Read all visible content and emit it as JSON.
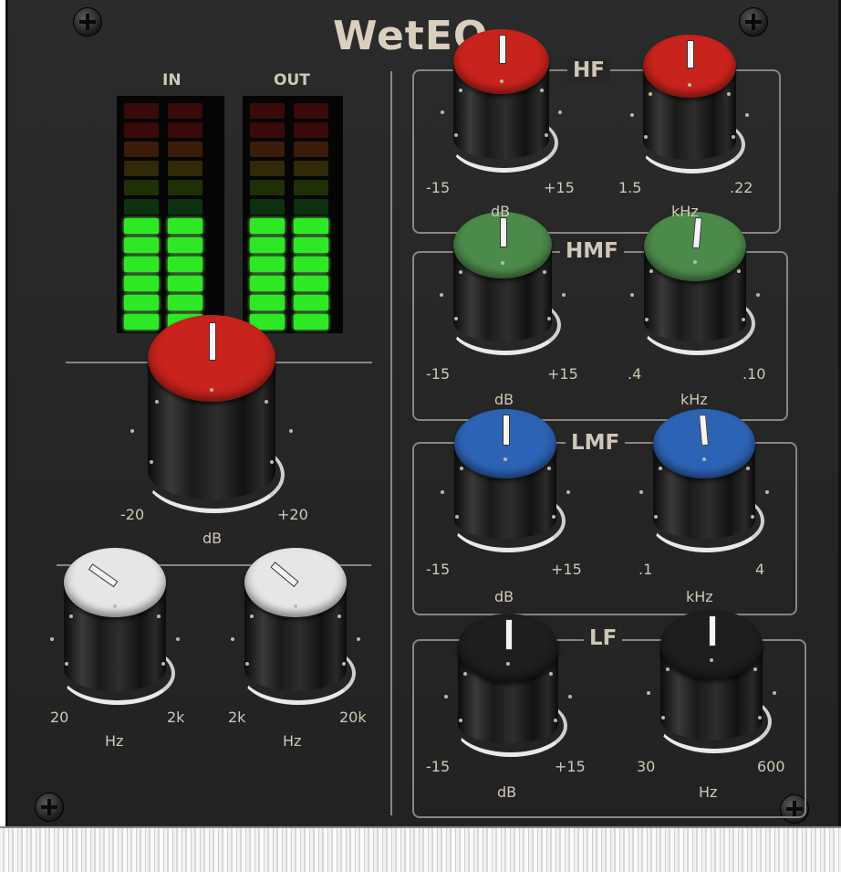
{
  "plugin": {
    "title": "WetEQ",
    "colors": {
      "panel": "#262626",
      "red_cap": "#c8231c",
      "green_cap": "#4c8a4a",
      "blue_cap": "#2d63b5",
      "white_cap": "#e6e6e6",
      "meter_on": "#2ee825"
    },
    "meters": {
      "in_label": "IN",
      "out_label": "OUT",
      "in_level_segments": 6,
      "out_level_segments": 6,
      "total_segments": 12
    },
    "gain": {
      "min": "-20",
      "max": "+20",
      "unit": "dB"
    },
    "hp_filter": {
      "min": "20",
      "max": "2k",
      "unit": "Hz"
    },
    "lp_filter": {
      "min": "2k",
      "max": "20k",
      "unit": "Hz"
    },
    "hf": {
      "title": "HF",
      "gain_min": "-15",
      "gain_max": "+15",
      "gain_unit": "dB",
      "freq_min": "1.5",
      "freq_max": ".22",
      "freq_unit": "kHz"
    },
    "hmf": {
      "title": "HMF",
      "gain_min": "-15",
      "gain_max": "+15",
      "gain_unit": "dB",
      "freq_min": ".4",
      "freq_max": ".10",
      "freq_unit": "kHz"
    },
    "lmf": {
      "title": "LMF",
      "gain_min": "-15",
      "gain_max": "+15",
      "gain_unit": "dB",
      "freq_min": ".1",
      "freq_max": "4",
      "freq_unit": "kHz"
    },
    "lf": {
      "title": "LF",
      "gain_min": "-15",
      "gain_max": "+15",
      "gain_unit": "dB",
      "freq_min": "30",
      "freq_max": "600",
      "freq_unit": "Hz"
    },
    "icons": {
      "screw": "screw-icon"
    }
  }
}
